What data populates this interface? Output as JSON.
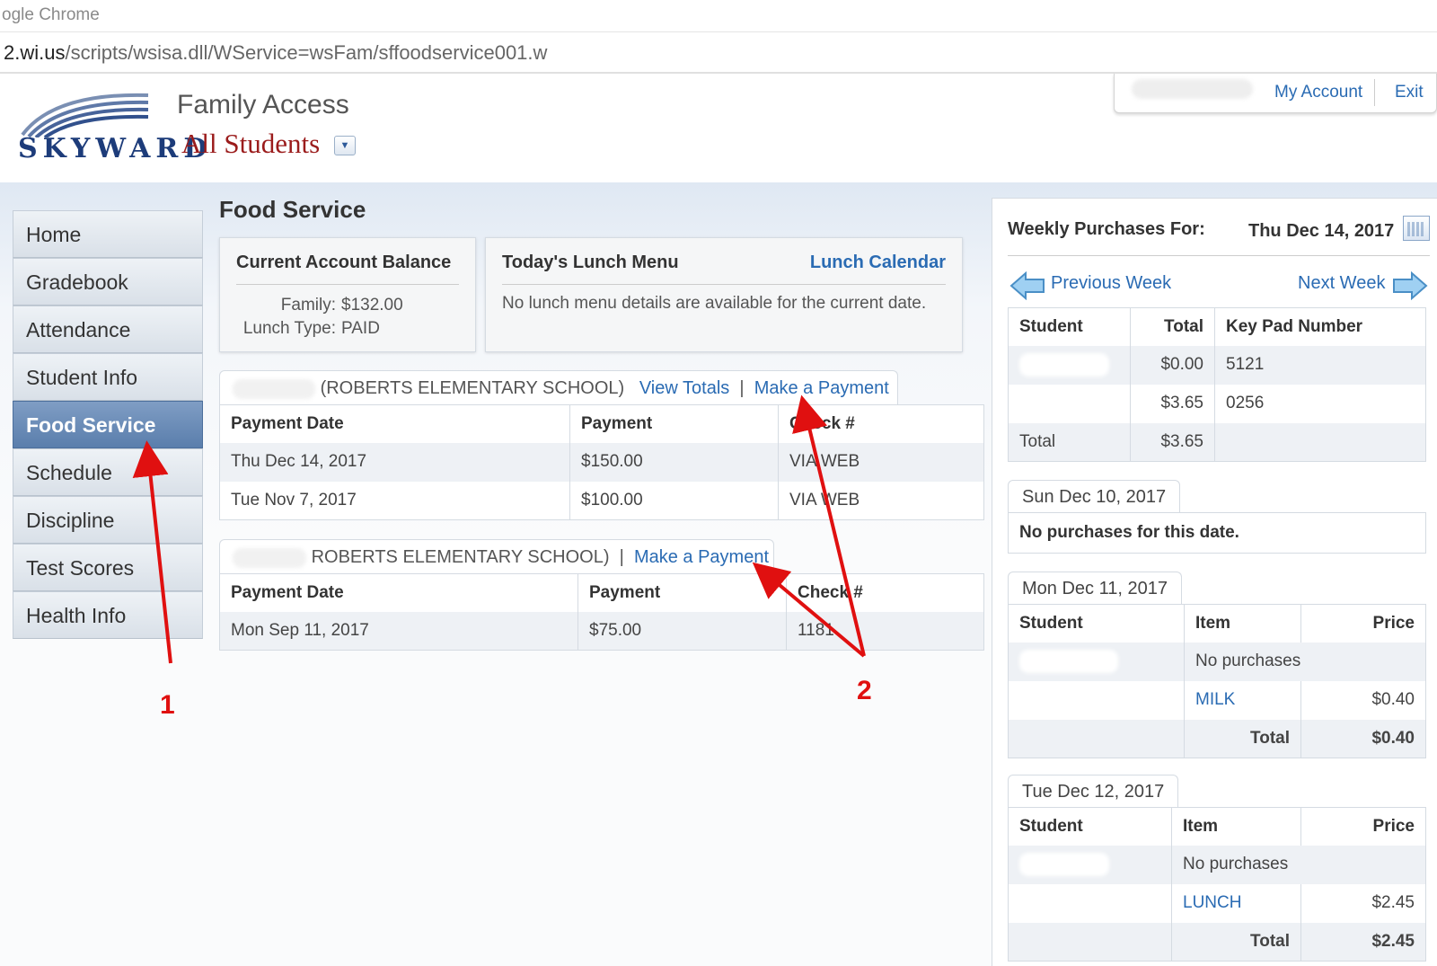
{
  "browser": {
    "title": "ogle Chrome",
    "url_host": "2.wi.us",
    "url_path": "/scripts/wsisa.dll/WService=wsFam/sffoodservice001.w"
  },
  "header": {
    "logo_text": "SKYWARD",
    "app_title": "Family Access",
    "student_selector": "All Students",
    "my_account": "My Account",
    "exit": "Exit"
  },
  "nav": {
    "items": [
      {
        "label": "Home"
      },
      {
        "label": "Gradebook"
      },
      {
        "label": "Attendance"
      },
      {
        "label": "Student Info"
      },
      {
        "label": "Food Service",
        "active": true
      },
      {
        "label": "Schedule"
      },
      {
        "label": "Discipline"
      },
      {
        "label": "Test Scores"
      },
      {
        "label": "Health Info"
      }
    ]
  },
  "main": {
    "title": "Food Service",
    "balance": {
      "heading": "Current Account Balance",
      "family_label": "Family:",
      "family_value": "$132.00",
      "lunch_type_label": "Lunch Type:",
      "lunch_type_value": "PAID"
    },
    "lunch_menu": {
      "heading": "Today's Lunch Menu",
      "calendar_link": "Lunch Calendar",
      "message": "No lunch menu details are available for the current date."
    },
    "accounts": [
      {
        "school": "(ROBERTS ELEMENTARY SCHOOL)",
        "view_totals": "View Totals",
        "separator": "|",
        "make_payment": "Make a Payment",
        "columns": [
          "Payment Date",
          "Payment",
          "Check #"
        ],
        "rows": [
          [
            "Thu Dec 14, 2017",
            "$150.00",
            "VIA WEB"
          ],
          [
            "Tue Nov 7, 2017",
            "$100.00",
            "VIA WEB"
          ]
        ]
      },
      {
        "prefix": ".",
        "school": "ROBERTS ELEMENTARY SCHOOL)",
        "separator": "|",
        "make_payment": "Make a Payment",
        "columns": [
          "Payment Date",
          "Payment",
          "Check #"
        ],
        "rows": [
          [
            "Mon Sep 11, 2017",
            "$75.00",
            "1181"
          ]
        ]
      }
    ]
  },
  "weekly": {
    "label": "Weekly Purchases For:",
    "date": "Thu Dec 14, 2017",
    "prev_week": "Previous Week",
    "next_week": "Next Week",
    "summary": {
      "columns": [
        "Student",
        "Total",
        "Key Pad Number"
      ],
      "rows": [
        [
          "",
          "$0.00",
          "5121"
        ],
        [
          "",
          "$3.65",
          "0256"
        ],
        [
          "Total",
          "$3.65",
          ""
        ]
      ]
    },
    "days": [
      {
        "date": "Sun Dec 10, 2017",
        "message": "No purchases for this date."
      },
      {
        "date": "Mon Dec 11, 2017",
        "columns": [
          "Student",
          "Item",
          "Price"
        ],
        "no_purchases": "No purchases",
        "item": "MILK",
        "price": "$0.40",
        "total_label": "Total",
        "total": "$0.40"
      },
      {
        "date": "Tue Dec 12, 2017",
        "columns": [
          "Student",
          "Item",
          "Price"
        ],
        "no_purchases": "No purchases",
        "item": "LUNCH",
        "price": "$2.45",
        "total_label": "Total",
        "total": "$2.45"
      }
    ]
  },
  "annotations": {
    "label_1": "1",
    "label_2": "2",
    "color": "#e01010"
  },
  "colors": {
    "link": "#2a6bb3",
    "nav_active": "#5a7eac",
    "brand_red": "#9b1c1c"
  }
}
